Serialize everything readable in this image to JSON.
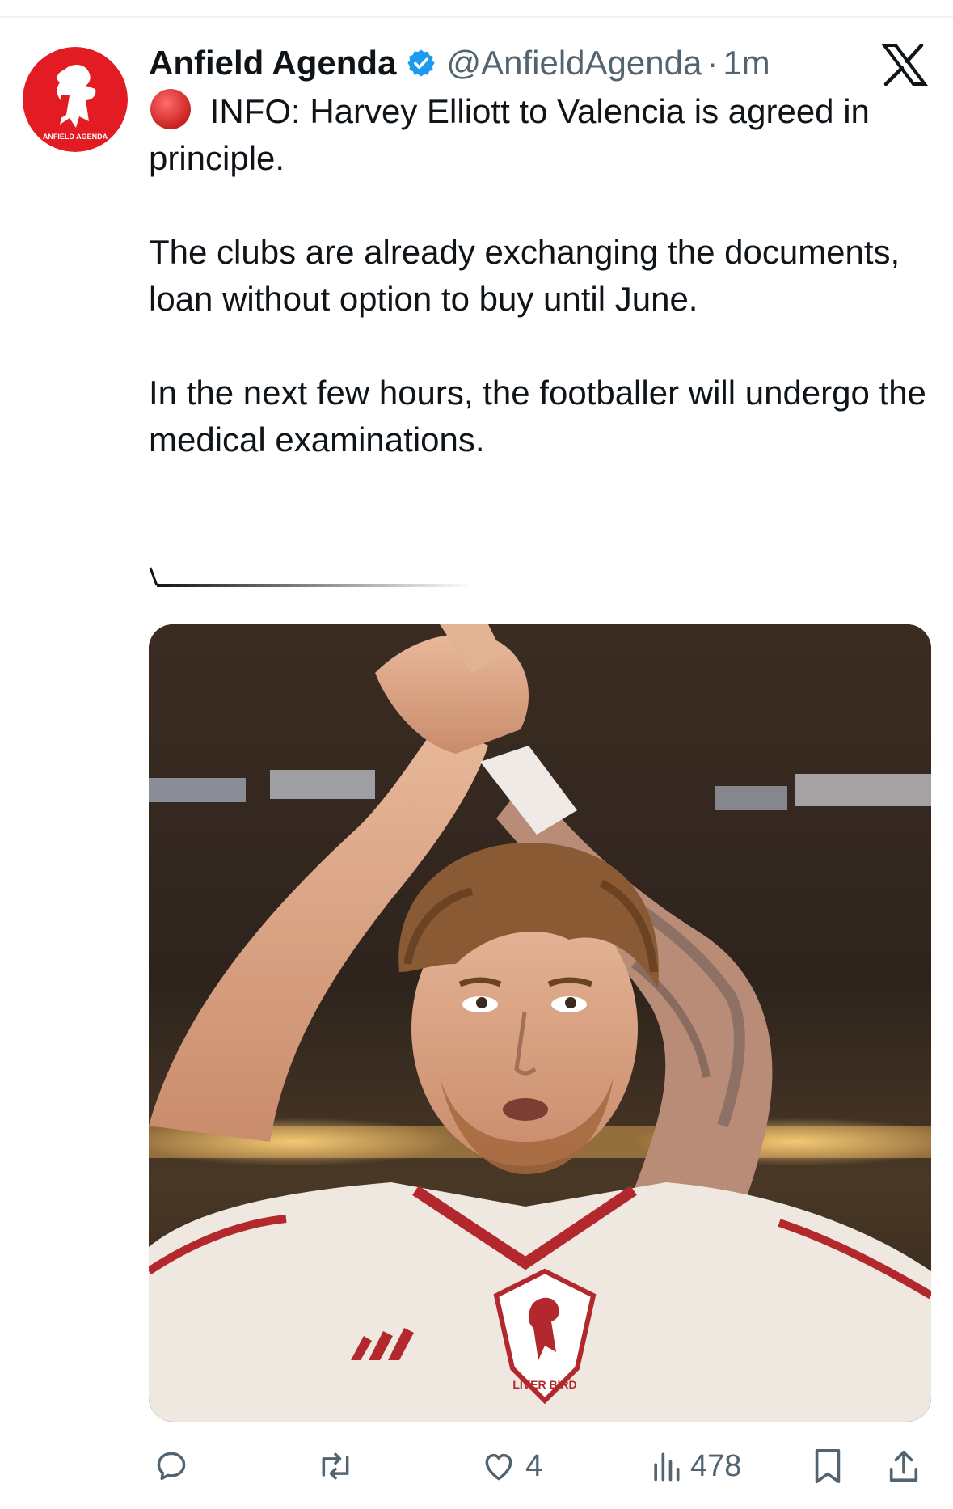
{
  "tweet": {
    "display_name": "Anfield Agenda",
    "handle": "@AnfieldAgenda",
    "separator": "·",
    "time": "1m",
    "verified": true,
    "avatar_text": "ANFIELD AGENDA",
    "paragraph1": " INFO: Harvey Elliott to Valencia is agreed in principle.",
    "paragraph2": "The clubs are already exchanging the documents, loan without option to buy until June.",
    "paragraph3": "In the next few hours, the footballer will undergo the medical examinations.",
    "media_alt_badges": [
      "adidas-logo",
      "liver-bird-crest"
    ],
    "media_crest_text": "LIVER BIRD"
  },
  "actions": {
    "reply_count": "",
    "retweet_count": "",
    "like_count": "4",
    "views_count": "478"
  },
  "colors": {
    "brand_red": "#e31b23",
    "verified_blue": "#1d9bf0",
    "muted": "#536471",
    "text": "#0f1419"
  },
  "icons": {
    "platform": "x-logo-icon",
    "reply": "reply-icon",
    "retweet": "retweet-icon",
    "like": "heart-icon",
    "views": "views-icon",
    "bookmark": "bookmark-icon",
    "share": "share-icon"
  }
}
